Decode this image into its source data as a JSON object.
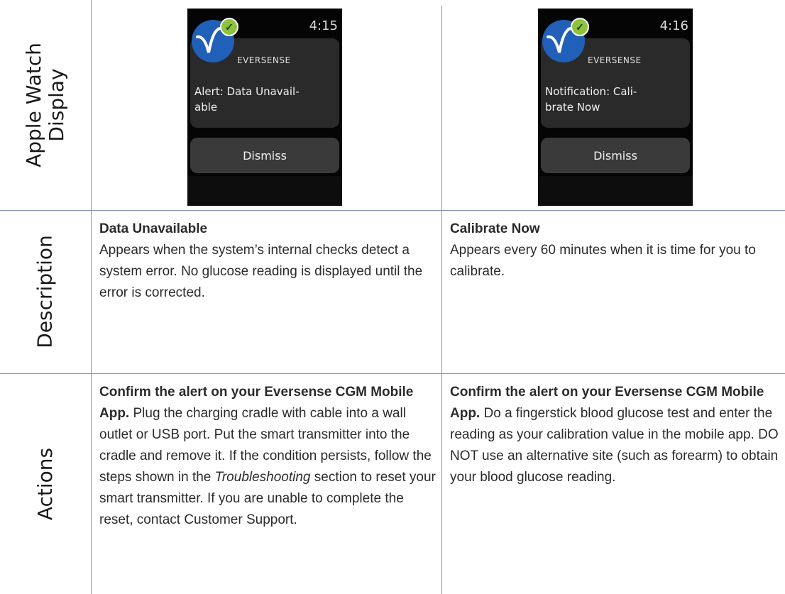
{
  "row_labels": {
    "display_line1": "Apple Watch",
    "display_line2": "Display",
    "description": "Description",
    "actions": "Actions"
  },
  "columns": [
    {
      "watch": {
        "time": "4:15",
        "brand": "EVERSENSE",
        "message_line1": "Alert: Data Unavail-",
        "message_line2": "able",
        "dismiss": "Dismiss"
      },
      "description": {
        "title": "Data Unavailable",
        "text": "Appears when the system’s internal checks detect a system error. No glucose reading is displayed until the error is corrected."
      },
      "actions": {
        "bold_lead": "Confirm the alert on your Eversense CGM Mobile App.",
        "text_before": " Plug the charging cradle with cable into a wall outlet or USB port. Put the smart transmitter into the cradle and remove it. If the condition persists, follow the steps shown in the ",
        "italic": "Troubleshooting",
        "text_after": " section to reset your smart transmitter. If you are unable to complete the reset, contact Customer Support."
      }
    },
    {
      "watch": {
        "time": "4:16",
        "brand": "EVERSENSE",
        "message_line1": "Notification: Cali-",
        "message_line2": "brate Now",
        "dismiss": "Dismiss"
      },
      "description": {
        "title": "Calibrate Now",
        "text": "Appears every 60 minutes when it is time for you to calibrate."
      },
      "actions": {
        "bold_lead": "Confirm the alert on your Eversense CGM Mobile App.",
        "text_before": " Do a fingerstick blood glucose test and enter the reading as your calibration value in the mobile app. DO NOT use an alternative site (such as forearm) to obtain your blood glucose reading.",
        "italic": "",
        "text_after": ""
      }
    }
  ],
  "colors": {
    "grid": "#7f93b8",
    "watch_logo": "#2160b8",
    "watch_check": "#8fc23c"
  },
  "icons": [
    "eversense-logo-icon",
    "checkmark-icon"
  ]
}
